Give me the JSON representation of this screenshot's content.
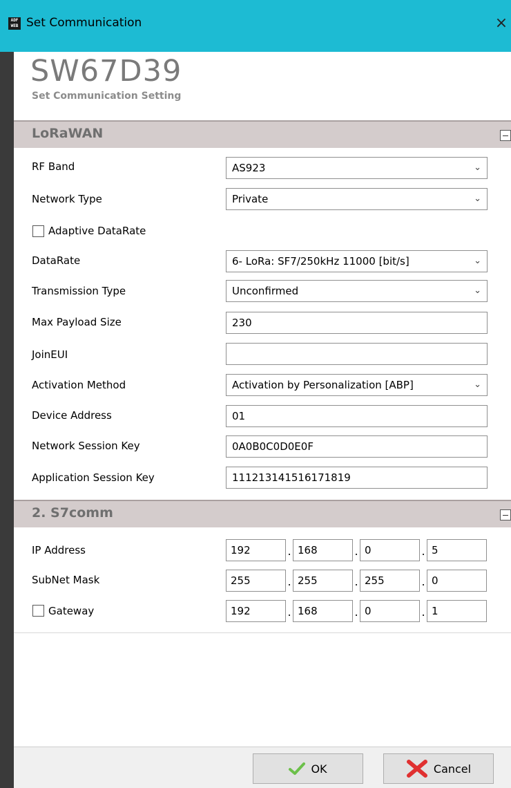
{
  "window": {
    "title": "Set Communication",
    "logo_text": "ADF WEB",
    "close_glyph": "×"
  },
  "header": {
    "app_name": "SW67D39",
    "subtitle": "Set Communication Setting"
  },
  "sections": {
    "lorawan": {
      "title": "LoRaWAN",
      "fields": {
        "rf_band": {
          "label": "RF Band",
          "value": "AS923"
        },
        "network_type": {
          "label": "Network Type",
          "value": "Private"
        },
        "adaptive_datarate": {
          "label": "Adaptive DataRate",
          "checked": false
        },
        "datarate": {
          "label": "DataRate",
          "value": "6- LoRa: SF7/250kHz 11000 [bit/s]"
        },
        "transmission_type": {
          "label": "Transmission Type",
          "value": "Unconfirmed"
        },
        "max_payload_size": {
          "label": "Max Payload Size",
          "value": "230"
        },
        "join_eui": {
          "label": "JoinEUI",
          "value": ""
        },
        "activation_method": {
          "label": "Activation Method",
          "value": "Activation by Personalization [ABP]"
        },
        "device_address": {
          "label": "Device Address",
          "value": "01"
        },
        "network_session_key": {
          "label": "Network Session Key",
          "value": "0A0B0C0D0E0F"
        },
        "application_session_key": {
          "label": "Application Session Key",
          "value": "111213141516171819"
        }
      }
    },
    "s7comm": {
      "title": "2. S7comm",
      "ip_address": {
        "label": "IP Address",
        "octets": [
          "192",
          "168",
          "0",
          "5"
        ]
      },
      "subnet_mask": {
        "label": "SubNet Mask",
        "octets": [
          "255",
          "255",
          "255",
          "0"
        ]
      },
      "gateway": {
        "label": "Gateway",
        "checked": false,
        "octets": [
          "192",
          "168",
          "0",
          "1"
        ]
      }
    }
  },
  "footer": {
    "ok_label": "OK",
    "cancel_label": "Cancel"
  },
  "colors": {
    "titlebar": "#1dbbd3",
    "section_header": "#d4cccc",
    "left_strip": "#3a3a3a",
    "ok_icon": "#6cc04a",
    "cancel_icon": "#e03030"
  },
  "icons": {
    "app": "adfweb-logo-icon",
    "close": "close-icon",
    "collapse": "collapse-minus-icon",
    "dropdown": "chevron-down-icon",
    "ok": "checkmark-icon",
    "cancel": "x-icon"
  }
}
